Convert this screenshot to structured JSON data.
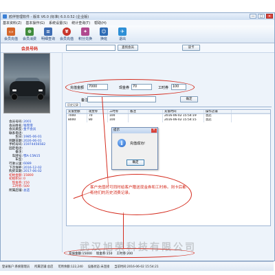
{
  "window": {
    "title": "鸥伴管理软件 - 版本 V6.0 (标准) 6.0.0.52 (企业版)",
    "controls": [
      "—",
      "□",
      "✕"
    ]
  },
  "menu": [
    "基本资料(Z)",
    "基本操作(G)",
    "系统设置(S)",
    "统计查询(T)",
    "帮助(H)"
  ],
  "toolbar": [
    {
      "label": "会员充值",
      "icon": "card-icon",
      "color": "#d4662a"
    },
    {
      "label": "会员消费",
      "icon": "cart-icon",
      "color": "#3f8b3c"
    },
    {
      "label": "明细查询",
      "icon": "list-icon",
      "color": "#3e6db3"
    },
    {
      "label": "会员充值",
      "icon": "coin-icon",
      "color": "#c8352b"
    },
    {
      "label": "积分兑换",
      "icon": "gift-icon",
      "color": "#b0498f"
    },
    {
      "label": "换班",
      "icon": "person-icon",
      "color": "#2d6bb5"
    },
    {
      "label": "退出",
      "icon": "exit-icon",
      "color": "#2d8fd6"
    }
  ],
  "search": {
    "label": "会员号码",
    "value": "",
    "search_button": "查找会员",
    "read_button": "读卡"
  },
  "member": {
    "rows": [
      {
        "k": "会员号码:",
        "v": "2001",
        "red": false
      },
      {
        "k": "会员姓名:",
        "v": "钱雪雪",
        "red": false
      },
      {
        "k": "会员类型:",
        "v": "金卡会员",
        "red": false
      },
      {
        "k": "联系电话:",
        "v": "",
        "red": false
      },
      {
        "k": "生日:",
        "v": "1985-06-01",
        "red": false
      },
      {
        "k": "到期日期:",
        "v": "2026-06-01",
        "red": false
      },
      {
        "k": "手机号码:",
        "v": "15974456582",
        "red": false
      },
      {
        "k": "固定电话:",
        "v": "",
        "red": false
      },
      {
        "k": "备注:",
        "v": "",
        "red": false
      },
      {
        "k": "车牌号:",
        "v": "鄂A-15N15",
        "red": false
      },
      {
        "k": "车型:",
        "v": "",
        "red": false
      },
      {
        "k": "行驶公里:",
        "v": "6089",
        "red": false
      },
      {
        "k": "下次保养:",
        "v": "2016-12-02",
        "red": false
      },
      {
        "k": "购买日期:",
        "v": "2017-06-02",
        "red": false
      },
      {
        "k": "初始金额:",
        "v": "15800",
        "red": true
      },
      {
        "k": "初始积分:",
        "v": "0",
        "red": true
      },
      {
        "k": "现金券:",
        "v": "150",
        "red": true
      },
      {
        "k": "工时券:",
        "v": "500",
        "red": true
      },
      {
        "k": "所属店铺:",
        "v": "总店",
        "red": false
      }
    ]
  },
  "recharge": {
    "amount_label": "充值金额",
    "amount": "7000",
    "cash_label": "现金券",
    "cash": "70",
    "hours_label": "工时券",
    "hours": "100",
    "note_label": "备注",
    "note": "",
    "confirm_button": "确定"
  },
  "history": {
    "tab": "历史记录",
    "columns": [
      "充值金额",
      "现金券",
      "工时券",
      "备注",
      "充值时间",
      "操作店铺"
    ],
    "rows": [
      [
        "7000",
        "70",
        "100",
        "",
        "2016-06-02 15:54:19",
        "总店"
      ],
      [
        "8000",
        "80",
        "100",
        "",
        "2016-06-02 15:54:15",
        "总店"
      ]
    ]
  },
  "dialog": {
    "title": "提示",
    "message": "充值成功!",
    "ok": "确定"
  },
  "callout": {
    "text": "客户充值时可同时给客户赠送现金券和工时券。则卡后都有他们的历史消费记录。"
  },
  "summary": {
    "total_amount": "充值金额:15000",
    "total_cash": "现金券:150",
    "total_hours": "工时券:200"
  },
  "status": {
    "left": "登录账户:系统管理员",
    "center": "所属店铺:总店",
    "balance": "可用余额:122,240",
    "device": "设备状态:未连接",
    "time": "当前时间:2016-06-02 15:54:21"
  },
  "watermark": "武汉旭荣科技有限公司"
}
